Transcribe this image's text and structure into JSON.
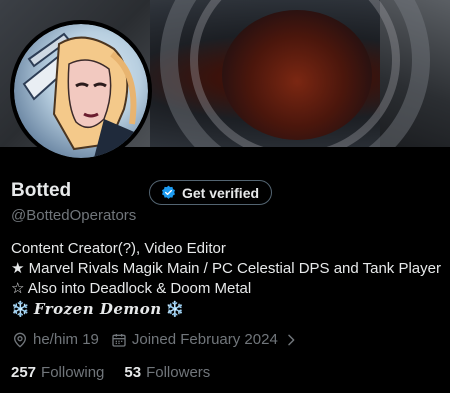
{
  "profile": {
    "name": "Botted",
    "handle": "@BottedOperators",
    "verify_label": "Get verified",
    "bio": {
      "line1": "Content Creator(?), Video Editor",
      "line2": "★ Marvel Rivals Magik Main / PC Celestial DPS and Tank Player",
      "line3": "☆ Also into Deadlock & Doom Metal",
      "line4_prefix": "❄️ ",
      "line4_text": "Frozen Demon",
      "line4_suffix": " ❄️"
    },
    "meta": {
      "pronouns": "he/him 19",
      "joined": "Joined February 2024"
    },
    "stats": {
      "following_count": "257",
      "following_label": "Following",
      "followers_count": "53",
      "followers_label": "Followers"
    }
  },
  "colors": {
    "background": "#000000",
    "text_primary": "#e7e9ea",
    "text_secondary": "#71767b",
    "verified_blue": "#1d9bf0"
  }
}
